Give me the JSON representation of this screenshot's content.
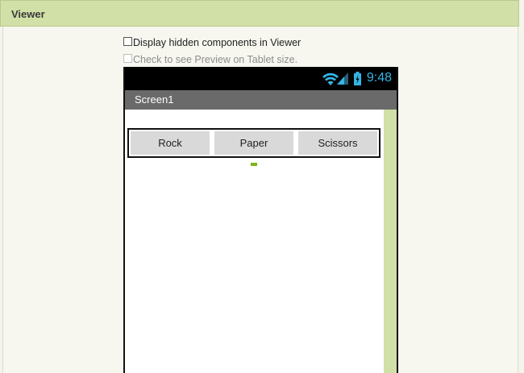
{
  "viewer": {
    "title": "Viewer",
    "options": {
      "hidden_components": "Display hidden components in Viewer",
      "tablet_preview": "Check to see Preview on Tablet size."
    }
  },
  "phone": {
    "status_time": "9:48",
    "screen_title": "Screen1",
    "buttons": [
      "Rock",
      "Paper",
      "Scissors"
    ]
  },
  "colors": {
    "header_bg": "#d1e0a6",
    "status_accent": "#33b5e5",
    "title_bar": "#6a6a6a",
    "button_bg": "#d9d9d9",
    "label_marker": "#7cb518"
  },
  "icons": [
    "wifi-icon",
    "signal-icon",
    "battery-icon"
  ]
}
